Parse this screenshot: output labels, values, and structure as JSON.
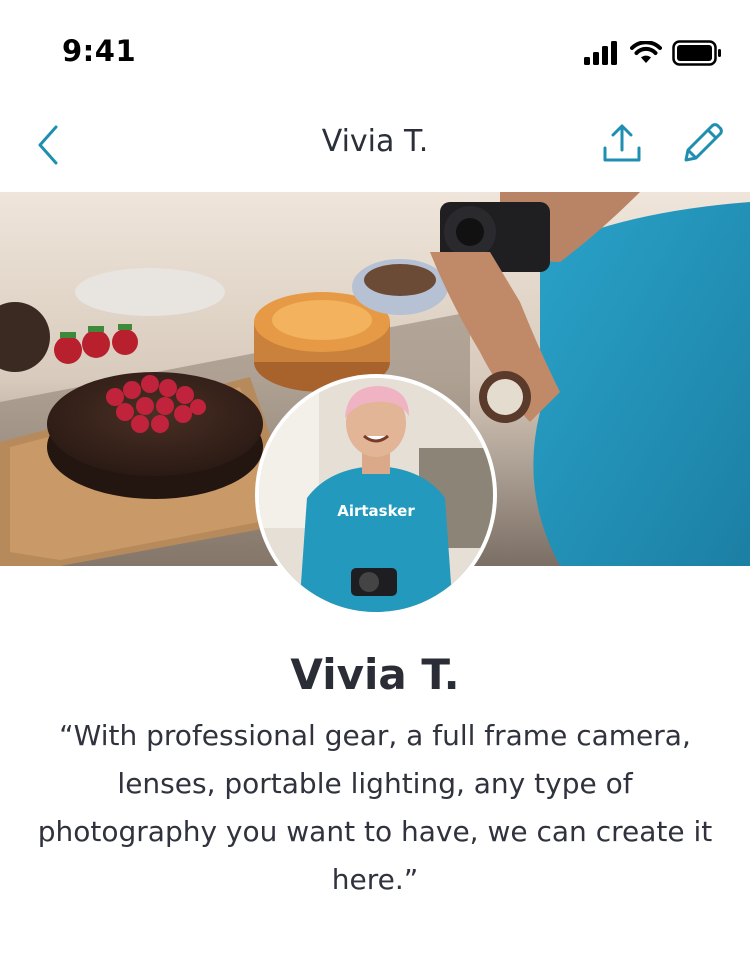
{
  "status_bar": {
    "time": "9:41",
    "icons": [
      "signal-icon",
      "wifi-icon",
      "battery-icon"
    ]
  },
  "nav": {
    "title": "Vivia T.",
    "back_icon": "chevron-left-icon",
    "share_icon": "share-icon",
    "edit_icon": "pencil-icon",
    "accent_color": "#1e8fb0"
  },
  "cover": {
    "description_icon": "cover-photo"
  },
  "avatar": {
    "shirt_text": "Airtasker"
  },
  "profile": {
    "name": "Vivia T.",
    "tagline": "“With professional gear, a full frame camera, lenses, portable lighting, any type of photography you want to have, we can create it here.”"
  }
}
